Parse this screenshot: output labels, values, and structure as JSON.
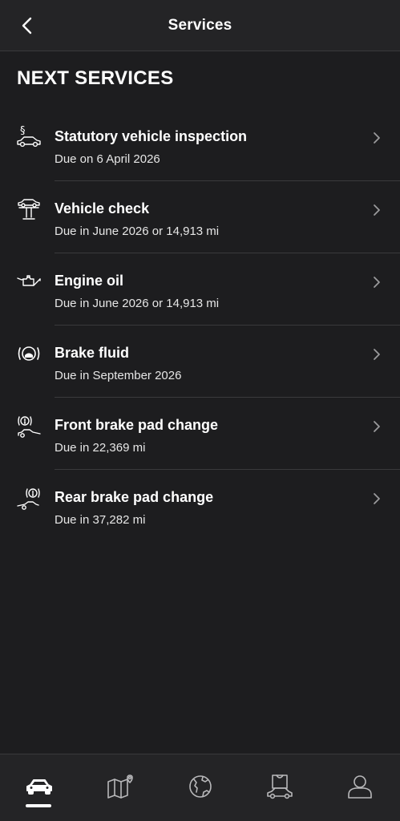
{
  "header": {
    "title": "Services",
    "back_icon": "chevron-left-icon"
  },
  "section": {
    "title": "NEXT SERVICES"
  },
  "services": [
    {
      "icon": "inspection-paragraph-car-icon",
      "title": "Statutory vehicle inspection",
      "subtitle": "Due on 6 April 2026"
    },
    {
      "icon": "vehicle-lift-icon",
      "title": "Vehicle check",
      "subtitle": "Due in June 2026 or 14,913 mi"
    },
    {
      "icon": "oil-can-icon",
      "title": "Engine oil",
      "subtitle": "Due in June 2026 or 14,913 mi"
    },
    {
      "icon": "brake-fluid-icon",
      "title": "Brake fluid",
      "subtitle": "Due in September 2026"
    },
    {
      "icon": "front-brake-pad-icon",
      "title": "Front brake pad change",
      "subtitle": "Due in 22,369 mi"
    },
    {
      "icon": "rear-brake-pad-icon",
      "title": "Rear brake pad change",
      "subtitle": "Due in 37,282 mi"
    }
  ],
  "bottom_nav": {
    "items": [
      {
        "icon": "car-icon",
        "active": true
      },
      {
        "icon": "map-icon",
        "active": false
      },
      {
        "icon": "globe-icon",
        "active": false
      },
      {
        "icon": "shop-car-icon",
        "active": false
      },
      {
        "icon": "profile-icon",
        "active": false
      }
    ]
  },
  "colors": {
    "background": "#1d1d1f",
    "header_bg": "#242426",
    "divider": "#3a3a3c",
    "text": "#ffffff",
    "chevron": "#9a9a9c"
  }
}
